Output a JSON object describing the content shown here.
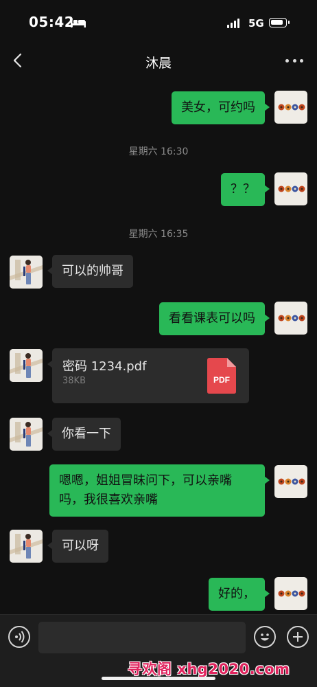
{
  "status_bar": {
    "time": "05:42",
    "network": "5G"
  },
  "header": {
    "title": "沐晨"
  },
  "messages": [
    {
      "from": "me",
      "text": "美女，可约吗"
    },
    {
      "type": "timestamp",
      "text": "星期六 16:30"
    },
    {
      "from": "me",
      "text": "？？"
    },
    {
      "type": "timestamp",
      "text": "星期六 16:35"
    },
    {
      "from": "her",
      "text": "可以的帅哥"
    },
    {
      "from": "me",
      "text": "看看课表可以吗"
    },
    {
      "from": "her",
      "type": "file",
      "name": "密码 1234.pdf",
      "size": "38KB",
      "badge": "PDF"
    },
    {
      "from": "her",
      "text": "你看一下"
    },
    {
      "from": "me",
      "text": "嗯嗯，姐姐冒昧问下，可以亲嘴吗，我很喜欢亲嘴"
    },
    {
      "from": "her",
      "text": "可以呀"
    },
    {
      "from": "me",
      "text": "好的，"
    }
  ],
  "input": {
    "placeholder": ""
  },
  "watermark": "寻欢阁 xhg2020.com",
  "colors": {
    "background": "#111111",
    "my_bubble": "#29b857",
    "her_bubble": "#2c2c2c",
    "pdf_red": "#e5484d"
  },
  "icons": [
    "back-arrow-icon",
    "more-icon",
    "voice-icon",
    "emoji-icon",
    "plus-icon",
    "pdf-icon"
  ]
}
